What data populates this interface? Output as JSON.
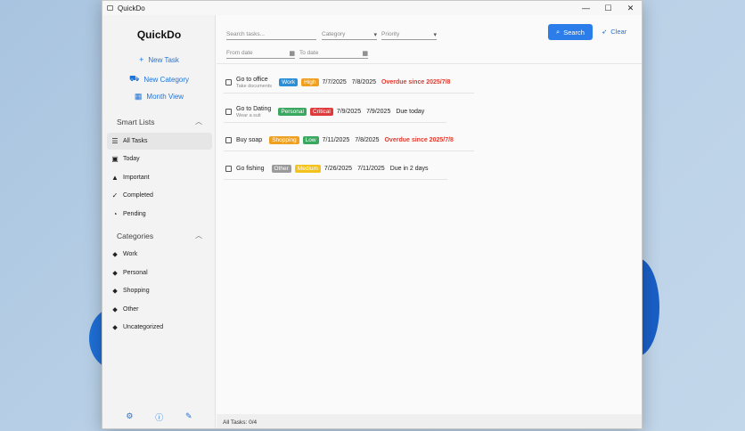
{
  "window": {
    "title": "QuickDo",
    "controls": {
      "minimize": "—",
      "maximize": "☐",
      "close": "✕"
    }
  },
  "sidebar": {
    "brand": "QuickDo",
    "actions": [
      {
        "label": "New Task",
        "icon": "plus-icon",
        "glyph": "+"
      },
      {
        "label": "New Category",
        "icon": "category-icon",
        "glyph": "⛟"
      },
      {
        "label": "Month View",
        "icon": "calendar-icon",
        "glyph": "▦"
      }
    ],
    "smart_lists": {
      "header": "Smart Lists",
      "items": [
        {
          "label": "All Tasks",
          "icon": "list-icon",
          "glyph": "☰",
          "active": true
        },
        {
          "label": "Today",
          "icon": "calendar-day-icon",
          "glyph": "▣"
        },
        {
          "label": "Important",
          "icon": "warning-icon",
          "glyph": "▲"
        },
        {
          "label": "Completed",
          "icon": "check-icon",
          "glyph": "✓"
        },
        {
          "label": "Pending",
          "icon": "clock-icon",
          "glyph": "◔"
        }
      ]
    },
    "categories": {
      "header": "Categories",
      "items": [
        {
          "label": "Work",
          "icon": "tag-icon",
          "glyph": "⬥"
        },
        {
          "label": "Personal",
          "icon": "tag-icon",
          "glyph": "⬥"
        },
        {
          "label": "Shopping",
          "icon": "tag-icon",
          "glyph": "⬥"
        },
        {
          "label": "Other",
          "icon": "tag-icon",
          "glyph": "⬥"
        },
        {
          "label": "Uncategorized",
          "icon": "tag-icon",
          "glyph": "⬥"
        }
      ]
    },
    "bottom_icons": [
      {
        "icon": "settings-icon",
        "glyph": "⚙"
      },
      {
        "icon": "info-icon",
        "glyph": "ⓘ"
      },
      {
        "icon": "brush-icon",
        "glyph": "✎"
      }
    ]
  },
  "filters": {
    "search_placeholder": "Search tasks...",
    "category_placeholder": "Category",
    "priority_placeholder": "Priority",
    "from_date_placeholder": "From date",
    "to_date_placeholder": "To date",
    "search_button": "Search",
    "clear_button": "Clear"
  },
  "tasks": [
    {
      "title": "Go to office",
      "subtitle": "Take documents",
      "category": "Work",
      "category_color": "#2b8fd8",
      "priority": "High",
      "priority_color": "#f0a020",
      "start": "7/7/2025",
      "due": "7/8/2025",
      "status": "Overdue since 2025/7/8",
      "overdue": true
    },
    {
      "title": "Go to Dating",
      "subtitle": "Wear a suit",
      "category": "Personal",
      "category_color": "#3aa860",
      "priority": "Critical",
      "priority_color": "#e03b3b",
      "start": "7/9/2025",
      "due": "7/9/2025",
      "status": "Due today",
      "overdue": false
    },
    {
      "title": "Buy soap",
      "subtitle": "",
      "category": "Shopping",
      "category_color": "#f0a020",
      "priority": "Low",
      "priority_color": "#3aa860",
      "start": "7/11/2025",
      "due": "7/8/2025",
      "status": "Overdue since 2025/7/8",
      "overdue": true
    },
    {
      "title": "Go fishing",
      "subtitle": "",
      "category": "Other",
      "category_color": "#9a9a9a",
      "priority": "Medium",
      "priority_color": "#f3c21c",
      "start": "7/26/2025",
      "due": "7/11/2025",
      "status": "Due in 2 days",
      "overdue": false
    }
  ],
  "statusbar": {
    "text": "All Tasks: 0/4"
  }
}
